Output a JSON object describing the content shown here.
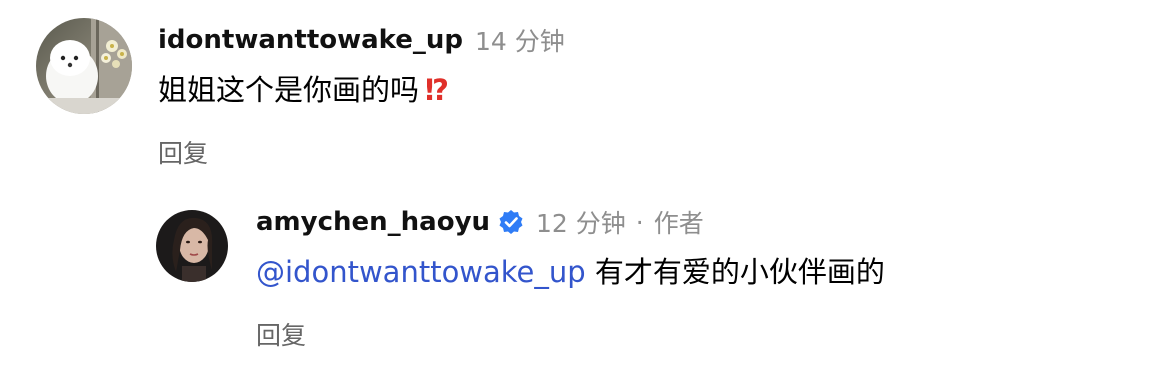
{
  "comments": [
    {
      "username": "idontwanttowake_up",
      "time": "14 分钟",
      "text": "姐姐这个是你画的吗",
      "emoji": "⁉",
      "reply_label": "回复",
      "avatar": "white-dog-with-flowers-avatar"
    },
    {
      "username": "amychen_haoyu",
      "verified": true,
      "time": "12 分钟",
      "separator": "·",
      "role": "作者",
      "mention": "@idontwanttowake_up",
      "text": "有才有爱的小伙伴画的",
      "reply_label": "回复",
      "avatar": "woman-portrait-avatar"
    }
  ],
  "colors": {
    "mention": "#3355cc",
    "verified_badge": "#2f7cf6",
    "meta": "#8e8e8e",
    "emoji": "#e0302a"
  }
}
